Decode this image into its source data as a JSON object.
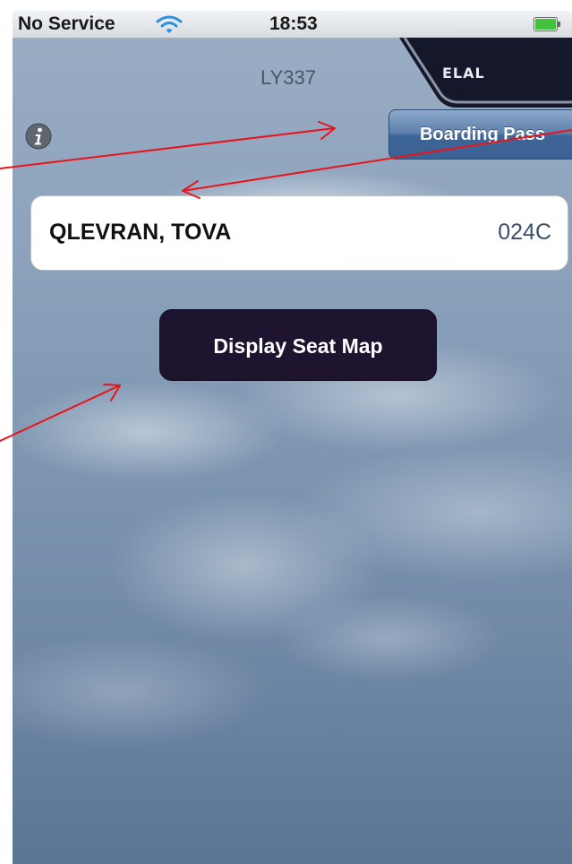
{
  "status_bar": {
    "carrier": "No Service",
    "time": "18:53",
    "wifi_icon": "wifi-icon",
    "battery_icon": "battery-icon"
  },
  "header": {
    "flight_number": "LY337",
    "logo_text": "ELAL",
    "info_icon": "info-icon"
  },
  "buttons": {
    "boarding_pass": "Boarding Pass",
    "display_seat_map": "Display Seat Map"
  },
  "passenger": {
    "name": "QLEVRAN, TOVA",
    "seat": "024C"
  },
  "colors": {
    "annotation_arrow": "#e8141c",
    "boarding_pass_button": "#3f6698",
    "seat_map_button": "#1e1430",
    "battery": "#42c23a"
  }
}
